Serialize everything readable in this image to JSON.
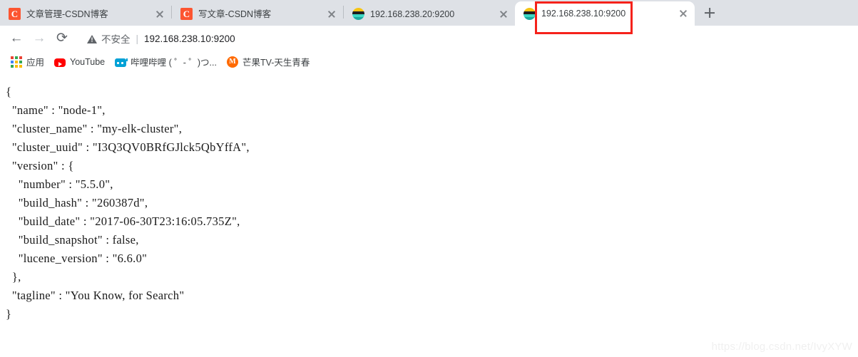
{
  "browser": {
    "tabs": [
      {
        "title": "文章管理-CSDN博客",
        "favicon": "csdn-favicon",
        "active": false
      },
      {
        "title": "写文章-CSDN博客",
        "favicon": "csdn-favicon",
        "active": false
      },
      {
        "title": "192.168.238.20:9200",
        "favicon": "elasticsearch-favicon",
        "active": false
      },
      {
        "title": "192.168.238.10:9200",
        "favicon": "elasticsearch-favicon",
        "active": true
      }
    ],
    "new_tab_label": "+",
    "toolbar": {
      "back_glyph": "←",
      "forward_glyph": "→",
      "reload_glyph": "⟳",
      "security_label": "不安全",
      "separator": "|",
      "url": "192.168.238.10:9200"
    },
    "bookmarks": [
      {
        "label": "应用",
        "icon": "apps-grid-icon"
      },
      {
        "label": "YouTube",
        "icon": "youtube-icon"
      },
      {
        "label": "哔哩哔哩 ( ゜- ゜)つ...",
        "icon": "bilibili-icon"
      },
      {
        "label": "芒果TV-天生青春",
        "icon": "mangotv-icon"
      }
    ],
    "annotation": {
      "color": "#f5221b",
      "target": "active-tab-title"
    }
  },
  "page": {
    "body": "{\n  \"name\" : \"node-1\",\n  \"cluster_name\" : \"my-elk-cluster\",\n  \"cluster_uuid\" : \"I3Q3QV0BRfGJlck5QbYffA\",\n  \"version\" : {\n    \"number\" : \"5.5.0\",\n    \"build_hash\" : \"260387d\",\n    \"build_date\" : \"2017-06-30T23:16:05.735Z\",\n    \"build_snapshot\" : false,\n    \"lucene_version\" : \"6.6.0\"\n  },\n  \"tagline\" : \"You Know, for Search\"\n}",
    "watermark": "https://blog.csdn.net/IvyXYW",
    "json_values": {
      "name": "node-1",
      "cluster_name": "my-elk-cluster",
      "cluster_uuid": "I3Q3QV0BRfGJlck5QbYffA",
      "version_number": "5.5.0",
      "build_hash": "260387d",
      "build_date": "2017-06-30T23:16:05.735Z",
      "build_snapshot": "false",
      "lucene_version": "6.6.0",
      "tagline": "You Know, for Search"
    }
  }
}
